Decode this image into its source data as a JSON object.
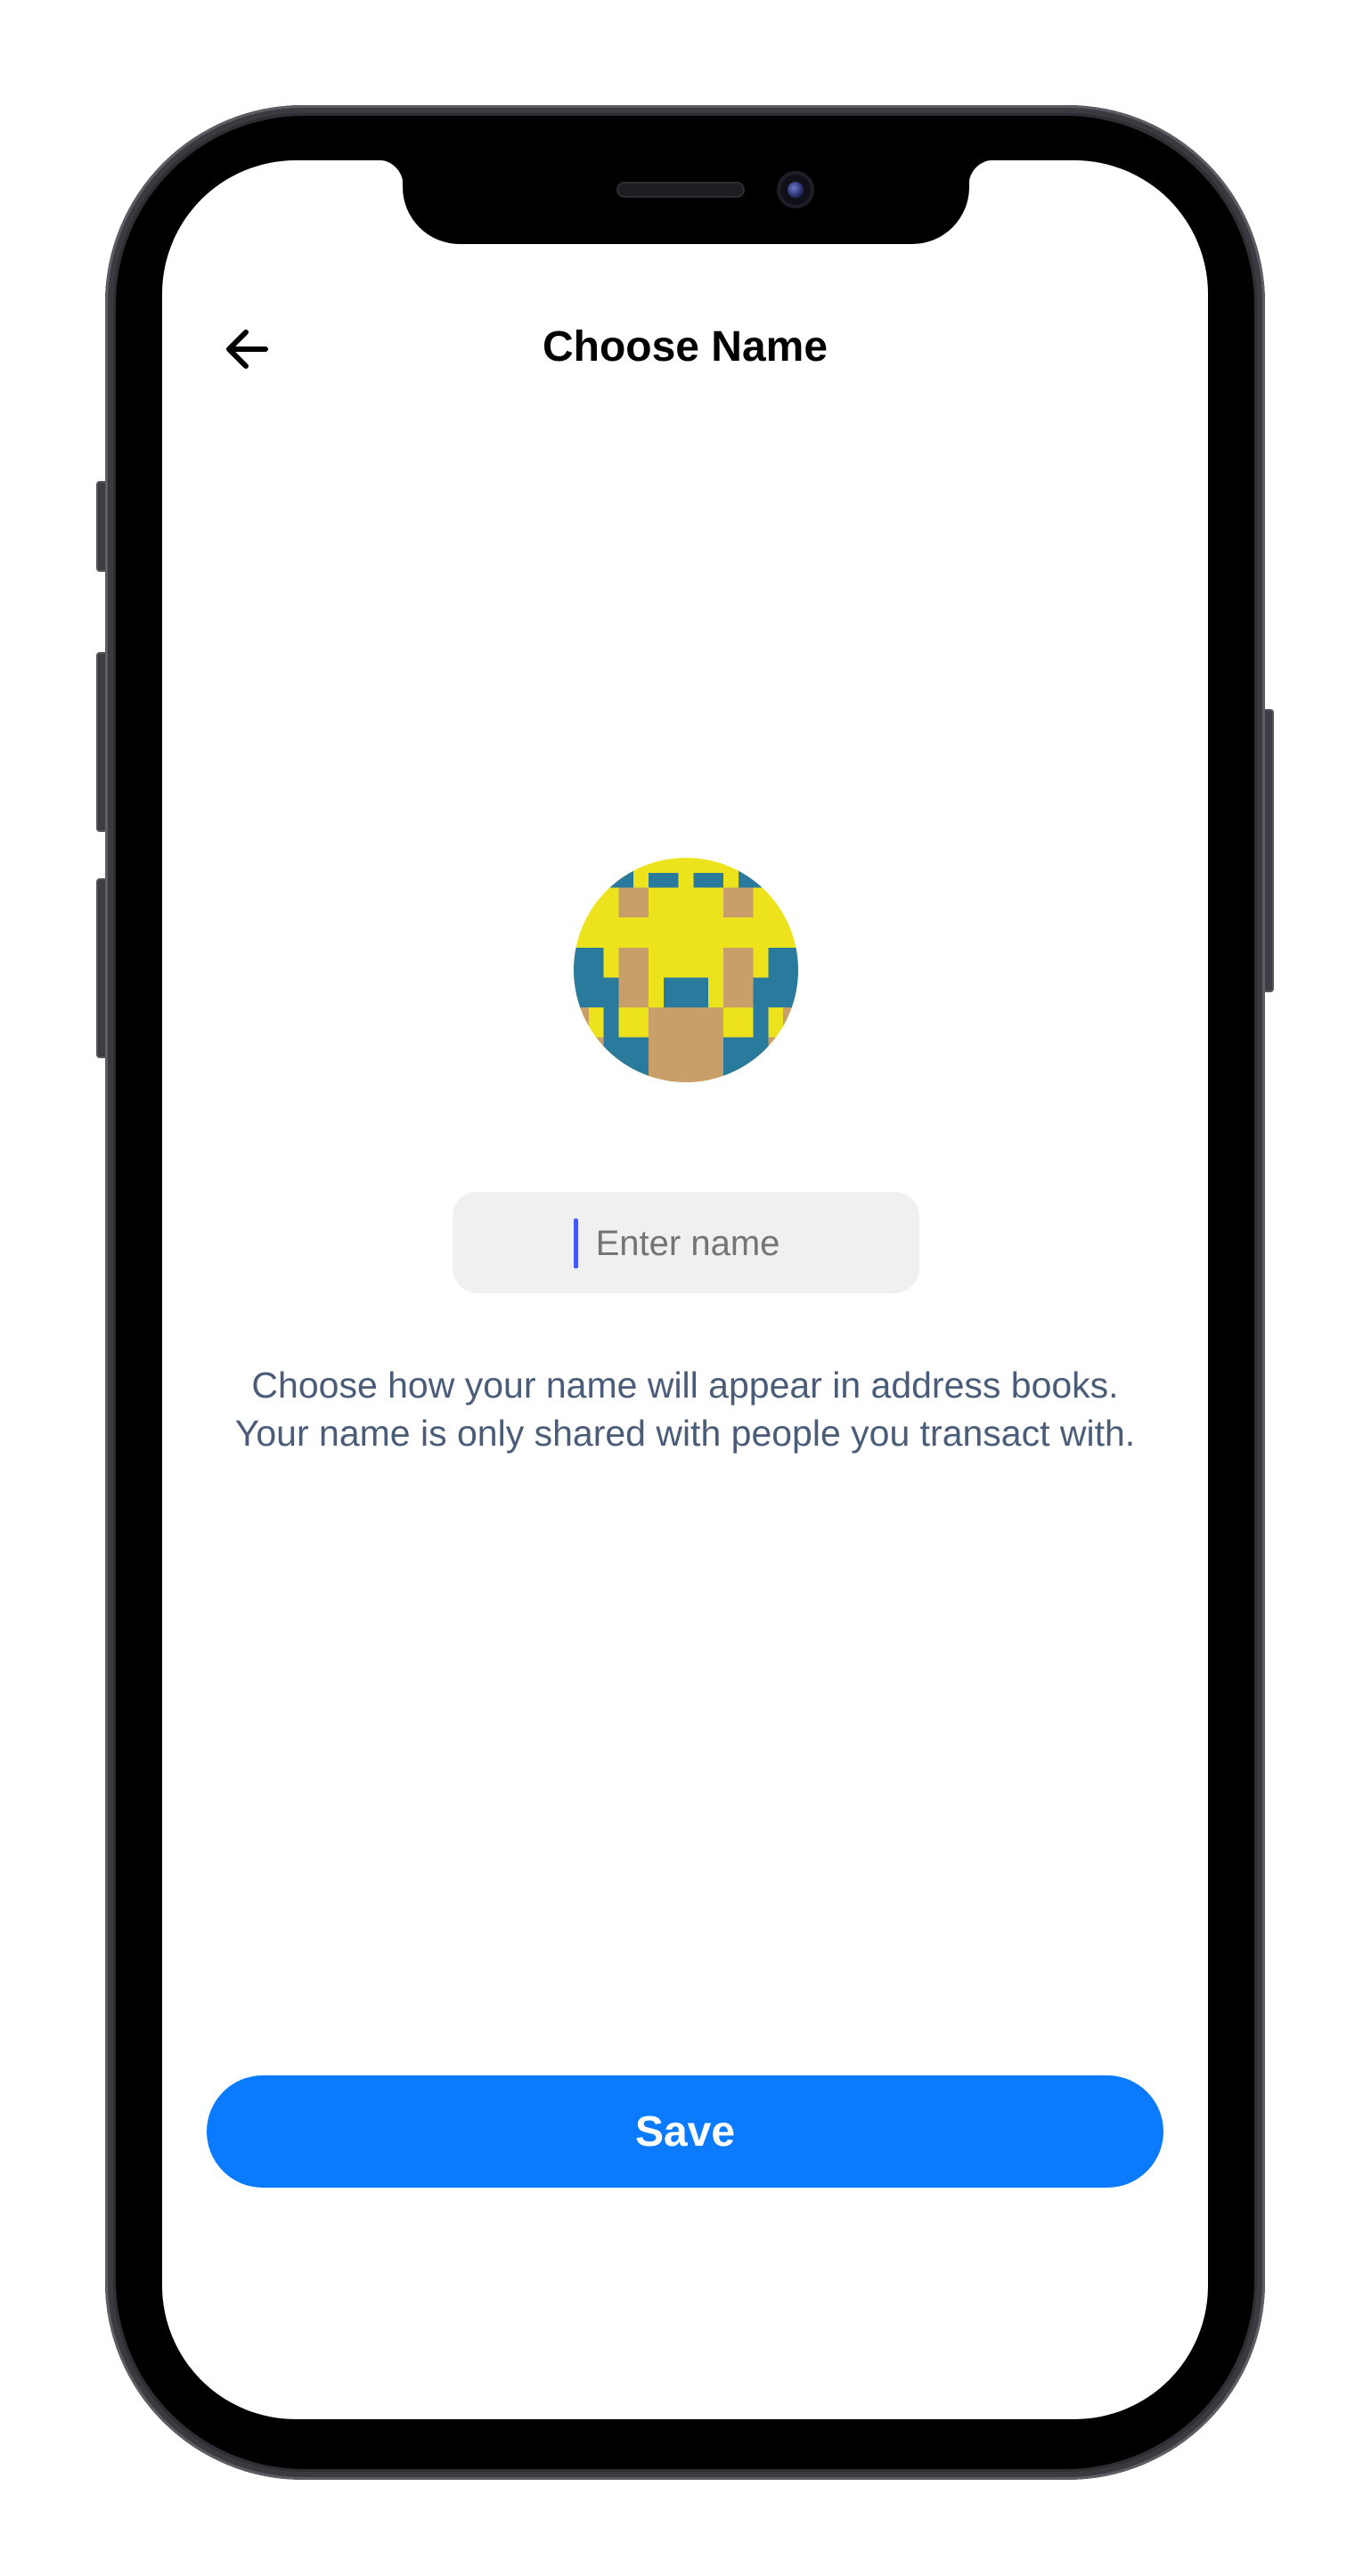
{
  "header": {
    "title": "Choose Name",
    "back_icon": "arrow-left-icon"
  },
  "avatar": {
    "icon": "pixel-identicon-avatar",
    "colors": {
      "primary": "#EDE31D",
      "secondary": "#C89E69",
      "tertiary": "#2A7A9E"
    }
  },
  "name_input": {
    "value": "",
    "placeholder": "Enter name"
  },
  "helper_text": "Choose how your name will appear in address books. Your name is only shared with people you transact with.",
  "save_button": {
    "label": "Save"
  },
  "colors": {
    "accent": "#0A7BFF",
    "helper_text": "#4A5C78",
    "input_bg": "#F0F0F0",
    "caret": "#4458FF"
  }
}
